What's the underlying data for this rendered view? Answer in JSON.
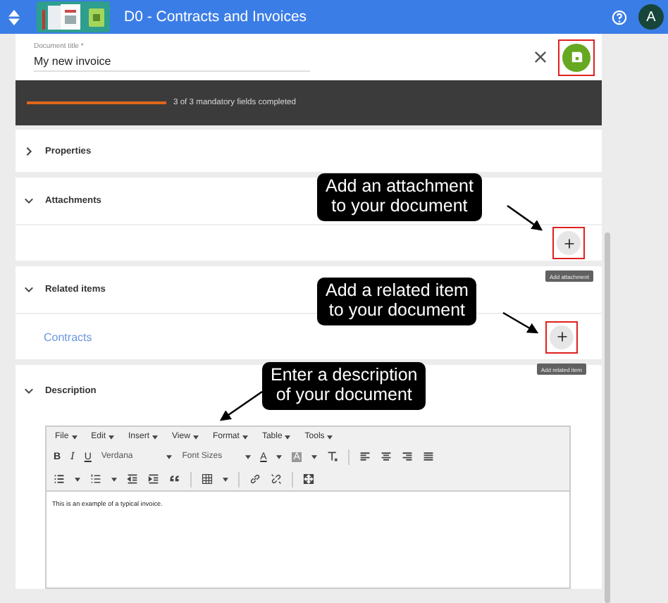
{
  "app_bar": {
    "title": "D0 - Contracts and Invoices",
    "avatar": "A"
  },
  "document_title": {
    "label": "Document title *",
    "value": "My new invoice"
  },
  "progress": {
    "level": 1,
    "text": "3 of 3 mandatory fields completed"
  },
  "sections": [
    {
      "kind": "plain",
      "title": "Properties",
      "expanded": false
    },
    {
      "kind": "attachments",
      "title": "Attachments",
      "expanded": true,
      "tooltip": "Add attachment"
    },
    {
      "kind": "related",
      "title": "Related items",
      "expanded": true,
      "tooltip": "Add related item",
      "links": [
        "Contracts"
      ]
    },
    {
      "kind": "editor",
      "title": "Description",
      "expanded": true
    }
  ],
  "editor": {
    "menus": [
      "File",
      "Edit",
      "Insert",
      "View",
      "Format",
      "Table",
      "Tools"
    ],
    "bold": "B",
    "italic": "I",
    "underline": "U",
    "font": "Verdana",
    "font_size": "Font Sizes",
    "text_color": "A",
    "background_color": "A",
    "content": "This is an example of a typical invoice."
  },
  "callouts": [
    {
      "text": "Add an attachment\nto your document"
    },
    {
      "text": "Add a related item\nto your document"
    },
    {
      "text": "Enter a description\nof your document"
    }
  ]
}
